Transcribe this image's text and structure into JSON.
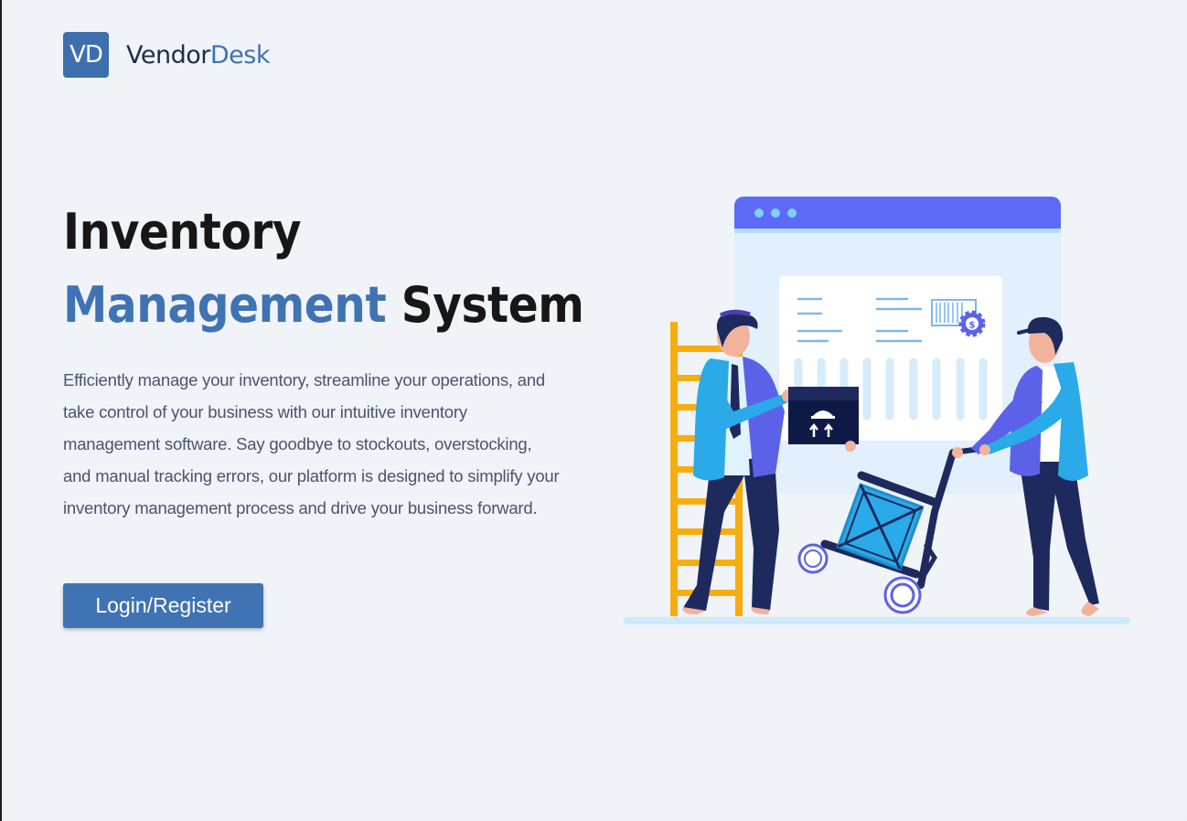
{
  "brand": {
    "mark": "VD",
    "name_primary": "Vendor",
    "name_accent": "Desk"
  },
  "hero": {
    "title_line1": "Inventory",
    "title_accent": "Management",
    "title_rest": " System",
    "description": "Efficiently manage your inventory, streamline your operations, and take control of your business with our intuitive inventory management software. Say goodbye to stockouts, overstocking, and manual tracking errors, our platform is designed to simplify your inventory management process and drive your business forward.",
    "cta_label": "Login/Register"
  },
  "illustration": {
    "icon": "warehouse-workers-illustration",
    "colors": {
      "browser_bar": "#5b6bf5",
      "panel": "#e1f0fc",
      "ladder": "#f7ad0e",
      "jacket_blue": "#2aaae8",
      "jacket_purple": "#5b62e8",
      "navy": "#1e2a5e"
    }
  },
  "colors": {
    "accent": "#3f73b3",
    "background": "#f0f3f8",
    "heading": "#171717",
    "body_text": "#4a556a"
  }
}
